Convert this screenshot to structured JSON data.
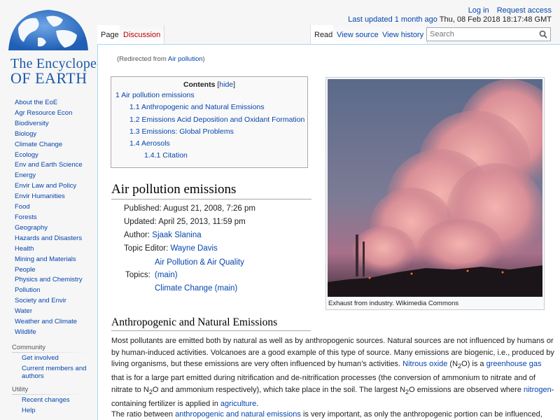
{
  "logo": {
    "line1": "The Encyclopedia",
    "line2": "OF EARTH"
  },
  "personal": {
    "login": "Log in",
    "request_access": "Request access",
    "last_updated_label": "Last updated 1 month ago",
    "last_updated_date": "Thu, 08 Feb 2018 18:17:48 GMT"
  },
  "tabs": {
    "page": "Page",
    "discussion": "Discussion",
    "read": "Read",
    "view_source": "View source",
    "view_history": "View history"
  },
  "search": {
    "placeholder": "Search"
  },
  "sidebar": {
    "items": [
      "About the EoE",
      "Agr Resource Econ",
      "Biodiversity",
      "Biology",
      "Climate Change",
      "Ecology",
      "Env and Earth Science",
      "Energy",
      "Envir Law and Policy",
      "Envir Humanities",
      "Food",
      "Forests",
      "Geography",
      "Hazards and Disasters",
      "Health",
      "Mining and Materials",
      "People",
      "Physics and Chemistry",
      "Pollution",
      "Society and Envir",
      "Water",
      "Weather and Climate",
      "Wildlife"
    ],
    "community_heading": "Community",
    "community": [
      "Get involved",
      "Current members and authors"
    ],
    "utility_heading": "Utility",
    "utility": [
      "Recent changes",
      "Help"
    ]
  },
  "redirect": {
    "prefix": "(Redirected from ",
    "link": "Air pollution",
    "suffix": ")"
  },
  "toc": {
    "title": "Contents",
    "hide_open": "[",
    "hide": "hide",
    "hide_close": "]",
    "items": [
      {
        "num": "1",
        "text": "Air pollution emissions"
      },
      {
        "num": "1.1",
        "text": "Anthropogenic and Natural Emissions"
      },
      {
        "num": "1.2",
        "text": "Emissions Acid Deposition and Oxidant Formation"
      },
      {
        "num": "1.3",
        "text": "Emissions: Global Problems"
      },
      {
        "num": "1.4",
        "text": "Aerosols"
      },
      {
        "num": "1.4.1",
        "text": "Citation"
      }
    ]
  },
  "figure": {
    "caption": "Exhaust from industry. Wikimedia Commons"
  },
  "article": {
    "title": "Air pollution emissions",
    "published": "Published: August 21, 2008, 7:26 pm",
    "updated": "Updated: April 25, 2013, 11:59 pm",
    "author_label": "Author: ",
    "author": "Sjaak Slanina",
    "editor_label": "Topic Editor: ",
    "editor": "Wayne Davis",
    "topics_label": "Topics:",
    "topics": [
      "Air Pollution & Air Quality",
      "(main)",
      "Climate Change (main)"
    ],
    "section_heading": "Anthropogenic and Natural Emissions",
    "p1": {
      "t1": "Most pollutants are emitted both by natural as well as by anthropogenic sources. Natural sources are not influenced by humans or by human-induced activities. Volcanoes are a good example of this type of source. Many emissions are biogenic, i.e., produced by living organisms, but these emissions are very often influenced by human’s activities. ",
      "l1": "Nitrous oxide",
      "t2": " (N",
      "sub1": "2",
      "t3": "O) is a ",
      "l2": "greenhouse gas",
      "t4": " that is for a large part emitted during nitrification and de-nitrification processes (the conversion of ammonium to nitrate and of nitrate to N",
      "sub2": "2",
      "t5": "O and ammonium respectively), which take place in the soil. The largest N",
      "sub3": "2",
      "t6": "O emissions are observed where ",
      "l3": "nitrogen",
      "t7": "-containing fertilizer is applied in ",
      "l4": "agriculture",
      "t8": "."
    },
    "p2": {
      "t1": "The ratio between ",
      "l1": "anthropogenic and natural emissions",
      "t2": " is very important, as only the anthropogenic portion can be influenced,"
    }
  }
}
